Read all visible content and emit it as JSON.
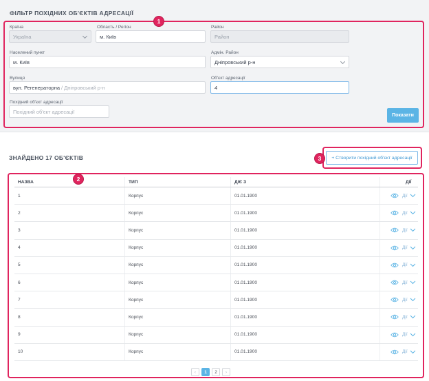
{
  "filter": {
    "title": "ФІЛЬТР ПОХІДНИХ ОБ'ЄКТІВ АДРЕСАЦІЇ",
    "country": {
      "label": "Країна",
      "value": "Україна"
    },
    "region": {
      "label": "Область / Регіон",
      "value": "м. Київ"
    },
    "district": {
      "label": "Район",
      "placeholder": "Район"
    },
    "settlement": {
      "label": "Населений пункт",
      "value": "м. Київ"
    },
    "admin_district": {
      "label": "Адмін. Район",
      "value": "Дніпровський р-н"
    },
    "street": {
      "label": "Вулиця",
      "value": "вул. Регенераторна",
      "suffix": "/ Дніпровський р-н"
    },
    "address_object": {
      "label": "Об'єкт адресації",
      "value": "4"
    },
    "derived_object": {
      "label": "Похідний об'єкт адресації",
      "placeholder": "Похідний об'єкт адресації"
    },
    "show_button": "Показати"
  },
  "badges": [
    "1",
    "2",
    "3"
  ],
  "results": {
    "title": "ЗНАЙДЕНО 17 ОБ'ЄКТІВ",
    "create_button": "+ Створити похідний об'єкт адресації"
  },
  "table": {
    "headers": [
      "НАЗВА",
      "ТИП",
      "ДІЄ З",
      "ДІЇ"
    ],
    "action_label": "Дії",
    "rows": [
      {
        "name": "1",
        "type": "Корпус",
        "since": "01.01.1900"
      },
      {
        "name": "2",
        "type": "Корпус",
        "since": "01.01.1900"
      },
      {
        "name": "3",
        "type": "Корпус",
        "since": "01.01.1900"
      },
      {
        "name": "4",
        "type": "Корпус",
        "since": "01.01.1900"
      },
      {
        "name": "5",
        "type": "Корпус",
        "since": "01.01.1900"
      },
      {
        "name": "6",
        "type": "Корпус",
        "since": "01.01.1900"
      },
      {
        "name": "7",
        "type": "Корпус",
        "since": "01.01.1900"
      },
      {
        "name": "8",
        "type": "Корпус",
        "since": "01.01.1900"
      },
      {
        "name": "9",
        "type": "Корпус",
        "since": "01.01.1900"
      },
      {
        "name": "10",
        "type": "Корпус",
        "since": "01.01.1900"
      }
    ]
  },
  "pagination": {
    "prev": "‹",
    "pages": [
      "1",
      "2"
    ],
    "active": "1",
    "next": "›"
  },
  "colors": {
    "accent": "#5bb4e5",
    "highlight": "#e0245e",
    "link": "#3d97d3"
  }
}
